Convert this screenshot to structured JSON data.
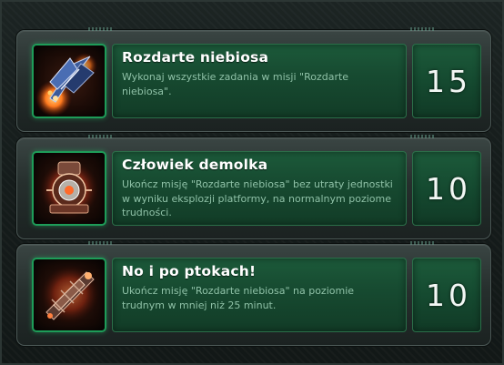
{
  "achievements": [
    {
      "title": "Rozdarte niebiosa",
      "description": "Wykonaj wszystkie zadania w misji \"Rozdarte niebiosa\".",
      "points": "15",
      "icon": "battlecruiser-icon"
    },
    {
      "title": "Człowiek demolka",
      "description": "Ukończ misję \"Rozdarte niebiosa\" bez utraty jednostki w wyniku eksplozji platformy, na normalnym poziome trudności.",
      "points": "10",
      "icon": "platform-reactor-icon"
    },
    {
      "title": "No i po ptokach!",
      "description": "Ukończ misję \"Rozdarte niebiosa\" na poziomie trudnym w mniej niż 25 minut.",
      "points": "10",
      "icon": "wrecked-ship-icon"
    }
  ],
  "colors": {
    "accent_green": "#1e9c58",
    "panel_green": "#174b31",
    "title_text": "#ffffff",
    "description_text": "#8fc1a7"
  }
}
